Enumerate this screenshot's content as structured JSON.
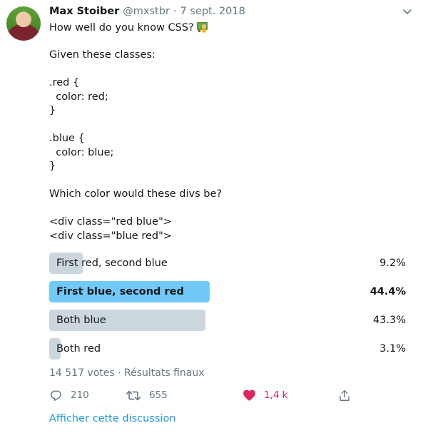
{
  "tweet": {
    "author_name": "Max Stoiber",
    "handle": "@mxstbr",
    "separator": "·",
    "date": "7 sept. 2018",
    "lines": [
      "How well do you know CSS?",
      "",
      "Given these classes:",
      "",
      ".red {",
      "  color: red;",
      "}",
      "",
      ".blue {",
      "  color: blue;",
      "}",
      "",
      "Which color would these divs be?",
      "",
      "<div class=\"red blue\">",
      "<div class=\"blue red\">"
    ],
    "title_emoji_icon": "teacher-emoji-icon"
  },
  "poll": {
    "options": [
      {
        "label": "First red, second blue",
        "percent_text": "9.2%",
        "percent": 9.2,
        "winner": false
      },
      {
        "label": "First blue, second red",
        "percent_text": "44.4%",
        "percent": 44.4,
        "winner": true
      },
      {
        "label": "Both blue",
        "percent_text": "43.3%",
        "percent": 43.3,
        "winner": false
      },
      {
        "label": "Both red",
        "percent_text": "3.1%",
        "percent": 3.1,
        "winner": false
      }
    ],
    "summary": "14 517 votes · Résultats finaux",
    "bar_color": "#ccd6dd",
    "winner_bar_color": "#71c9f8"
  },
  "actions": {
    "reply_count": "210",
    "retweet_count": "655",
    "like_count": "1,4 k",
    "reply_icon": "reply-icon",
    "retweet_icon": "retweet-icon",
    "like_icon": "heart-icon",
    "share_icon": "share-icon",
    "like_color": "#e0245e"
  },
  "footer": {
    "show_thread": "Afficher cette discussion",
    "link_color": "#1b95e0"
  }
}
